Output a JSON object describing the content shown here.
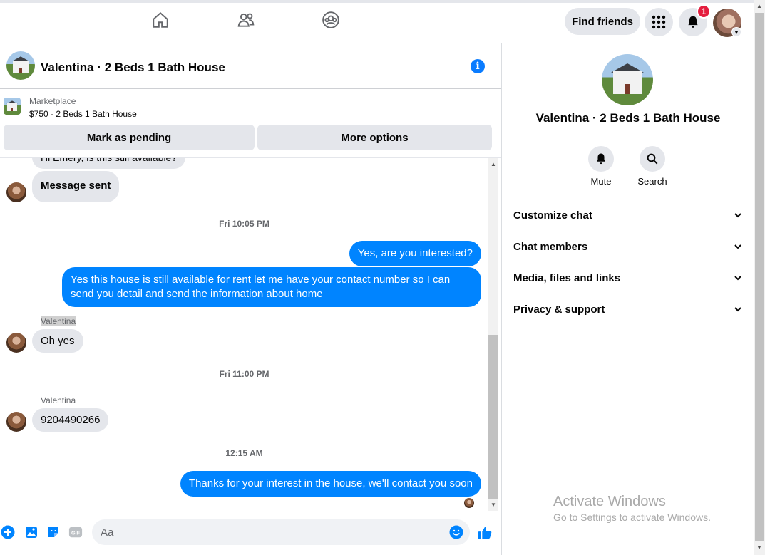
{
  "nav": {
    "find_friends_label": "Find friends",
    "notification_count": "1",
    "icons": [
      "home-icon",
      "friends-icon",
      "groups-icon",
      "menu-grid-icon",
      "bell-icon"
    ]
  },
  "chat": {
    "title": "Valentina · 2 Beds 1 Bath House"
  },
  "marketplace": {
    "label": "Marketplace",
    "item": "$750 - 2 Beds 1 Bath House",
    "mark_pending_label": "Mark as pending",
    "more_options_label": "More options"
  },
  "messages": {
    "partial_top": "Hi Emery, is this still available?",
    "m1": "Message sent",
    "ts1": "Fri 10:05 PM",
    "m2": "Yes, are you interested?",
    "m3": "Yes this house is still available for rent let me have your contact number so I can send you detail and send the information about home",
    "sender1": "Valentina",
    "m4": "Oh yes",
    "ts2": "Fri 11:00 PM",
    "sender2": "Valentina",
    "m5": "9204490266",
    "ts3": "12:15 AM",
    "m6": "Thanks for your interest in the house, we'll contact you soon"
  },
  "composer": {
    "placeholder": "Aa"
  },
  "right_panel": {
    "title": "Valentina · 2 Beds 1 Bath House",
    "mute_label": "Mute",
    "search_label": "Search",
    "sections": [
      "Customize chat",
      "Chat members",
      "Media, files and links",
      "Privacy & support"
    ]
  },
  "watermark": {
    "line1": "Activate Windows",
    "line2": "Go to Settings to activate Windows."
  },
  "colors": {
    "accent": "#0084ff",
    "incoming_bubble": "#e4e6eb",
    "badge": "#e41e3f"
  }
}
